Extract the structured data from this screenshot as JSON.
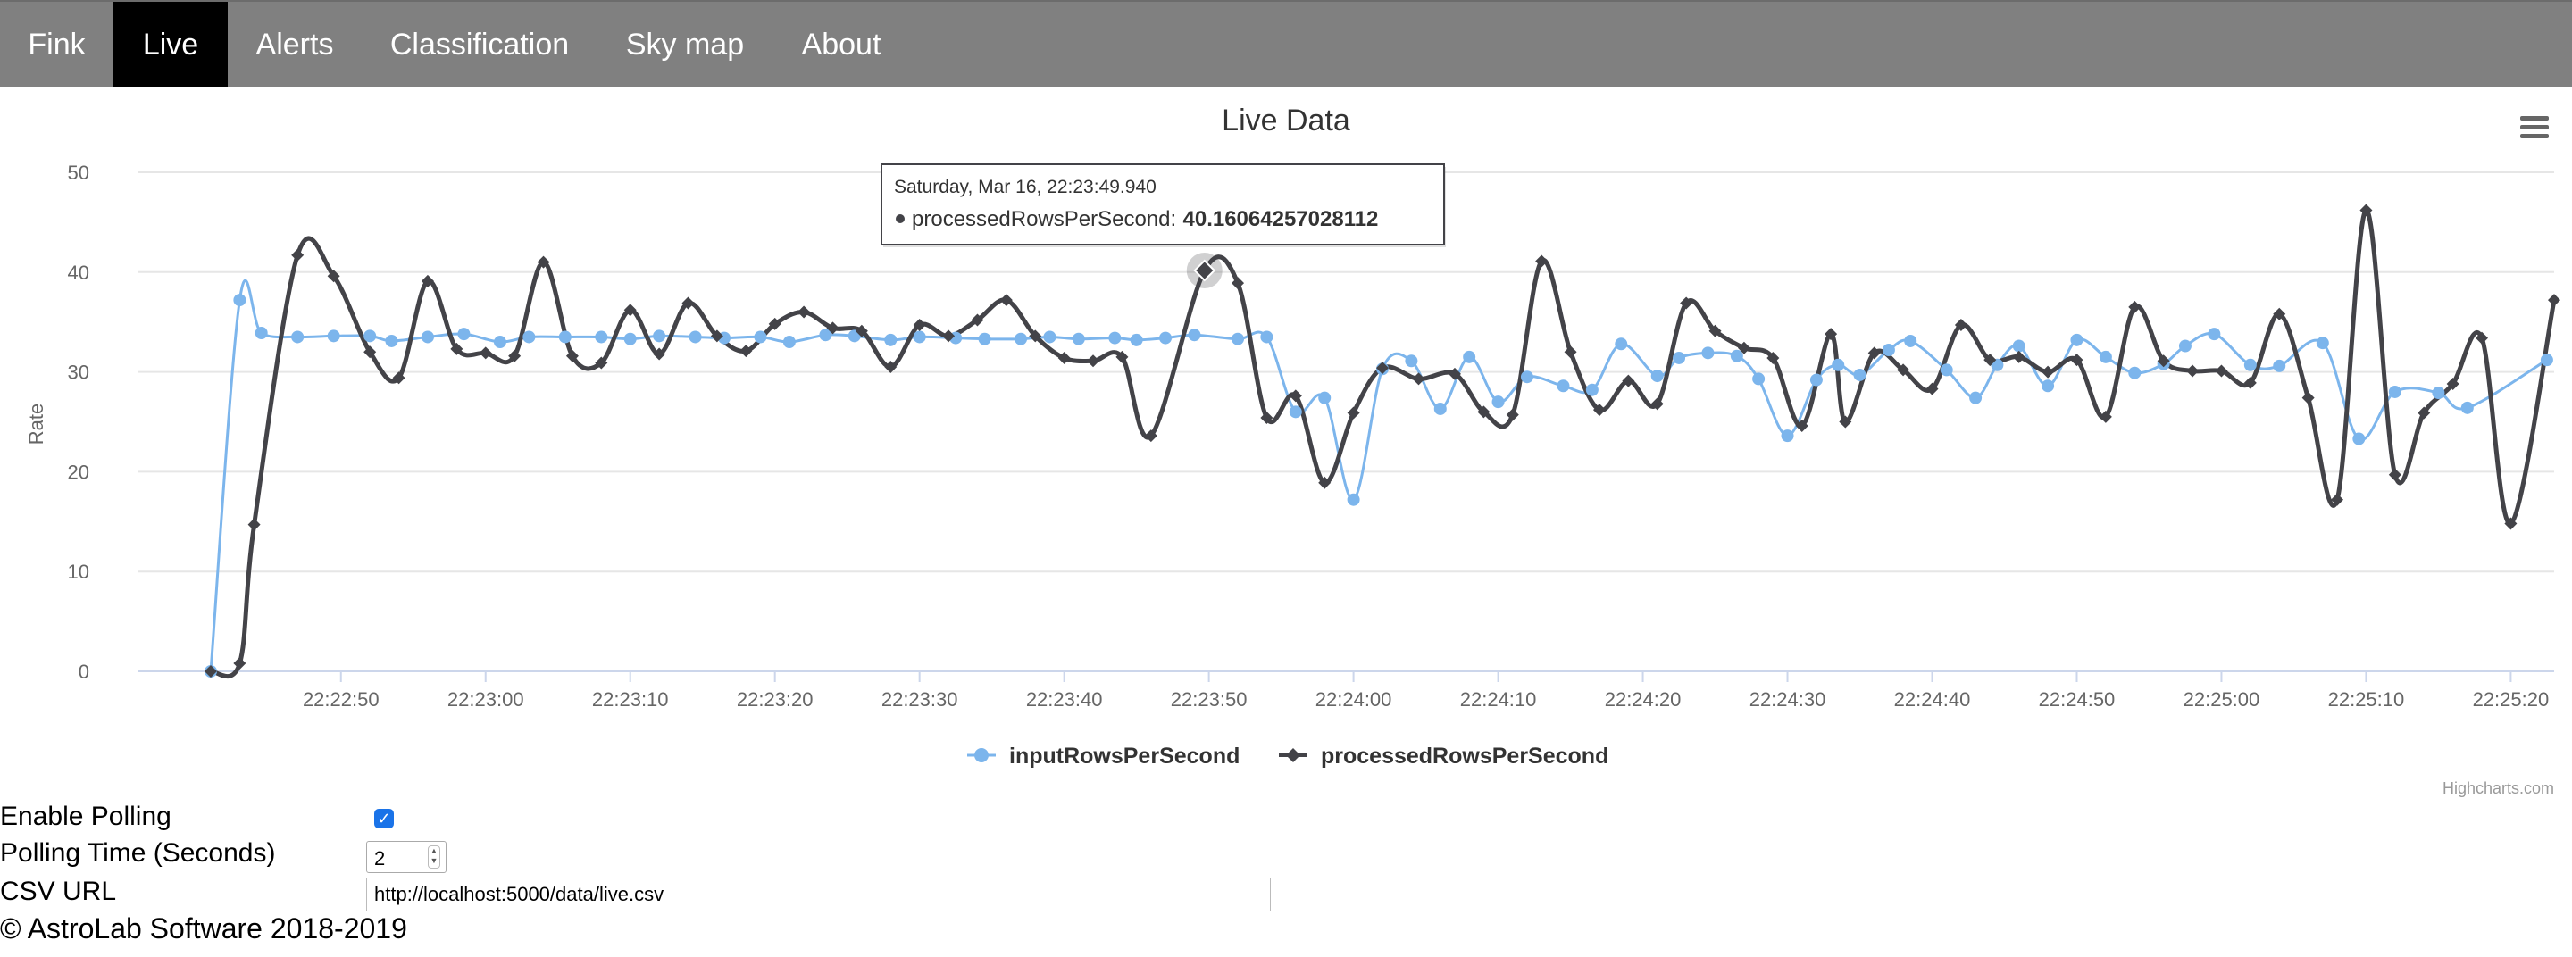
{
  "nav": {
    "items": [
      {
        "label": "Fink",
        "active": false
      },
      {
        "label": "Live",
        "active": true
      },
      {
        "label": "Alerts",
        "active": false
      },
      {
        "label": "Classification",
        "active": false
      },
      {
        "label": "Sky map",
        "active": false
      },
      {
        "label": "About",
        "active": false
      }
    ]
  },
  "chart_data": {
    "type": "line",
    "title": "Live Data",
    "ylabel": "Rate",
    "xlabel": "",
    "ylim": [
      0,
      50
    ],
    "y_ticks": [
      0,
      10,
      20,
      30,
      40,
      50
    ],
    "x_tick_labels": [
      "22:22:50",
      "22:23:00",
      "22:23:10",
      "22:23:20",
      "22:23:30",
      "22:23:40",
      "22:23:50",
      "22:24:00",
      "22:24:10",
      "22:24:20",
      "22:24:30",
      "22:24:40",
      "22:24:50",
      "22:25:00",
      "22:25:10",
      "22:25:20"
    ],
    "x_tick_seconds": [
      50,
      60,
      70,
      80,
      90,
      100,
      110,
      120,
      130,
      140,
      150,
      160,
      170,
      180,
      190,
      200
    ],
    "x_range_seconds": [
      36,
      203
    ],
    "x_unit": "seconds after 22:22:00",
    "grid": true,
    "legend_position": "bottom-center",
    "series": [
      {
        "name": "inputRowsPerSecond",
        "color": "#7cb5ec",
        "marker": "circle",
        "points": [
          [
            41,
            0
          ],
          [
            43,
            37.2
          ],
          [
            44.5,
            33.9
          ],
          [
            47,
            33.5
          ],
          [
            49.5,
            33.6
          ],
          [
            52,
            33.6
          ],
          [
            53.5,
            33.1
          ],
          [
            56,
            33.5
          ],
          [
            58.5,
            33.8
          ],
          [
            61,
            33.0
          ],
          [
            63,
            33.5
          ],
          [
            65.5,
            33.5
          ],
          [
            68,
            33.5
          ],
          [
            70,
            33.3
          ],
          [
            72,
            33.6
          ],
          [
            74.5,
            33.5
          ],
          [
            76.5,
            33.4
          ],
          [
            79,
            33.5
          ],
          [
            81,
            33.0
          ],
          [
            83.5,
            33.7
          ],
          [
            85.5,
            33.6
          ],
          [
            88,
            33.2
          ],
          [
            90,
            33.5
          ],
          [
            92.5,
            33.4
          ],
          [
            94.5,
            33.3
          ],
          [
            97,
            33.3
          ],
          [
            99,
            33.5
          ],
          [
            101,
            33.3
          ],
          [
            103.5,
            33.4
          ],
          [
            105,
            33.2
          ],
          [
            107,
            33.4
          ],
          [
            109,
            33.7
          ],
          [
            112,
            33.3
          ],
          [
            114,
            33.5
          ],
          [
            116,
            26.0
          ],
          [
            118,
            27.4
          ],
          [
            120,
            17.2
          ],
          [
            122,
            30.3
          ],
          [
            124,
            31.1
          ],
          [
            126,
            26.3
          ],
          [
            128,
            31.5
          ],
          [
            130,
            27.0
          ],
          [
            132,
            29.5
          ],
          [
            134.5,
            28.6
          ],
          [
            136.5,
            28.2
          ],
          [
            138.5,
            32.8
          ],
          [
            141,
            29.6
          ],
          [
            142.5,
            31.4
          ],
          [
            144.5,
            31.9
          ],
          [
            146.5,
            31.6
          ],
          [
            148,
            29.3
          ],
          [
            150,
            23.6
          ],
          [
            152,
            29.2
          ],
          [
            153.5,
            30.7
          ],
          [
            155,
            29.7
          ],
          [
            157,
            32.2
          ],
          [
            158.5,
            33.1
          ],
          [
            161,
            30.2
          ],
          [
            163,
            27.4
          ],
          [
            164.5,
            30.7
          ],
          [
            166,
            32.6
          ],
          [
            168,
            28.6
          ],
          [
            170,
            33.2
          ],
          [
            172,
            31.5
          ],
          [
            174,
            29.9
          ],
          [
            176,
            30.8
          ],
          [
            177.5,
            32.6
          ],
          [
            179.5,
            33.8
          ],
          [
            182,
            30.7
          ],
          [
            184,
            30.6
          ],
          [
            187,
            32.9
          ],
          [
            189.5,
            23.3
          ],
          [
            192,
            28.0
          ],
          [
            195,
            27.9
          ],
          [
            197,
            26.4
          ],
          [
            202.5,
            31.2
          ]
        ]
      },
      {
        "name": "processedRowsPerSecond",
        "color": "#434348",
        "marker": "diamond",
        "points": [
          [
            41,
            0
          ],
          [
            43,
            0.8
          ],
          [
            44,
            14.7
          ],
          [
            47,
            41.7
          ],
          [
            49.5,
            39.6
          ],
          [
            52,
            32.0
          ],
          [
            54,
            29.4
          ],
          [
            56,
            39.1
          ],
          [
            58,
            32.3
          ],
          [
            60,
            31.9
          ],
          [
            62,
            31.6
          ],
          [
            64,
            41.0
          ],
          [
            66,
            31.6
          ],
          [
            68,
            30.9
          ],
          [
            70,
            36.2
          ],
          [
            72,
            31.8
          ],
          [
            74,
            36.9
          ],
          [
            76,
            33.6
          ],
          [
            78,
            32.1
          ],
          [
            80,
            34.8
          ],
          [
            82,
            36.0
          ],
          [
            84,
            34.4
          ],
          [
            86,
            34.1
          ],
          [
            88,
            30.5
          ],
          [
            90,
            34.7
          ],
          [
            92,
            33.6
          ],
          [
            94,
            35.2
          ],
          [
            96,
            37.2
          ],
          [
            98,
            33.6
          ],
          [
            100,
            31.4
          ],
          [
            102,
            31.1
          ],
          [
            104,
            31.5
          ],
          [
            106,
            23.6
          ],
          [
            109.7,
            40.16064257028112
          ],
          [
            112,
            38.9
          ],
          [
            114,
            25.4
          ],
          [
            116,
            27.6
          ],
          [
            118,
            18.9
          ],
          [
            120,
            25.9
          ],
          [
            122,
            30.4
          ],
          [
            124.5,
            29.3
          ],
          [
            127,
            29.8
          ],
          [
            129,
            26.0
          ],
          [
            131,
            25.7
          ],
          [
            133,
            41.1
          ],
          [
            135,
            32.0
          ],
          [
            137,
            26.2
          ],
          [
            139,
            29.1
          ],
          [
            141,
            26.8
          ],
          [
            143,
            36.9
          ],
          [
            145,
            34.1
          ],
          [
            147,
            32.4
          ],
          [
            149,
            31.4
          ],
          [
            151,
            24.6
          ],
          [
            153,
            33.8
          ],
          [
            154,
            25.0
          ],
          [
            156,
            31.9
          ],
          [
            158,
            30.2
          ],
          [
            160,
            28.3
          ],
          [
            162,
            34.7
          ],
          [
            164,
            31.2
          ],
          [
            166,
            31.5
          ],
          [
            168,
            30.0
          ],
          [
            170,
            31.2
          ],
          [
            172,
            25.5
          ],
          [
            174,
            36.5
          ],
          [
            176,
            31.1
          ],
          [
            178,
            30.1
          ],
          [
            180,
            30.1
          ],
          [
            182,
            28.9
          ],
          [
            184,
            35.8
          ],
          [
            186,
            27.4
          ],
          [
            188,
            17.2
          ],
          [
            190,
            46.2
          ],
          [
            192,
            19.7
          ],
          [
            194,
            25.9
          ],
          [
            196,
            28.8
          ],
          [
            198,
            33.4
          ],
          [
            200,
            14.8
          ],
          [
            203,
            37.2
          ]
        ]
      }
    ],
    "tooltip": {
      "date_label": "Saturday, Mar 16, 22:23:49.940",
      "series_name": "processedRowsPerSecond",
      "value_text": "40.16064257028112",
      "x": 109.7,
      "y": 40.16064257028112
    },
    "credits": "Highcharts.com"
  },
  "controls": {
    "polling_label": "Enable Polling",
    "polling_enabled": true,
    "polling_time_label": "Polling Time (Seconds)",
    "polling_time_value": "2",
    "csv_label": "CSV URL",
    "csv_url": "http://localhost:5000/data/live.csv"
  },
  "footer": {
    "text": "© AstroLab Software 2018-2019"
  }
}
